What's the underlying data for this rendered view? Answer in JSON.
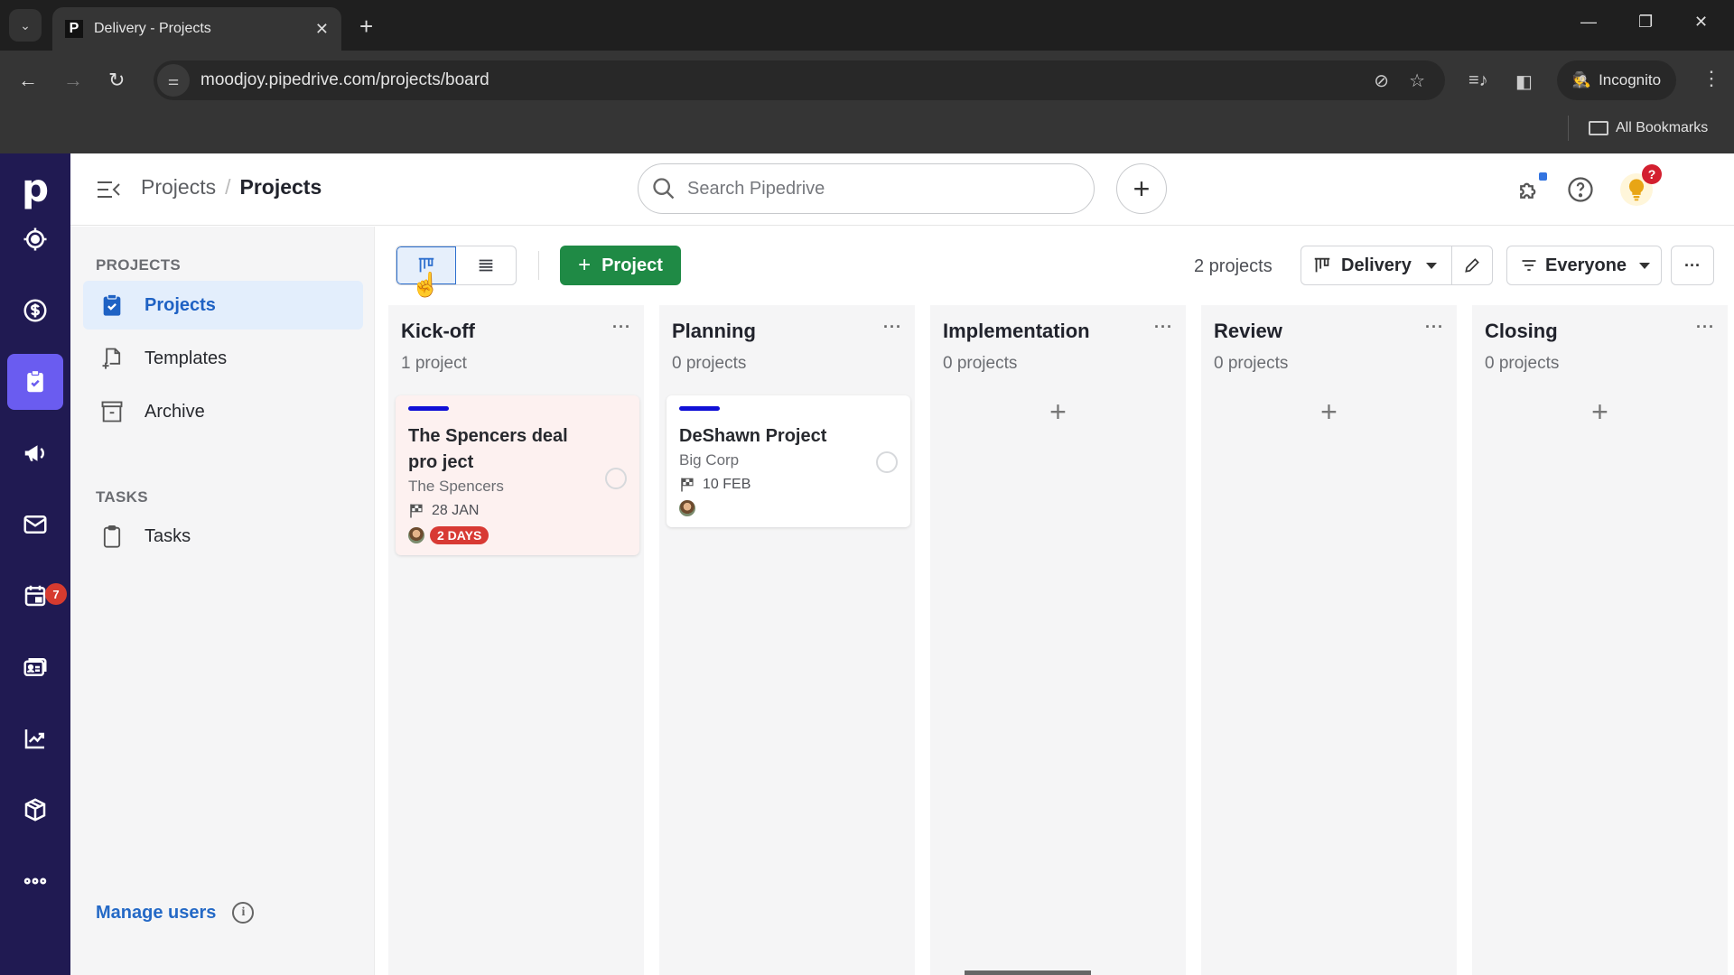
{
  "browser": {
    "tab_title": "Delivery - Projects",
    "tab_favicon": "P",
    "url": "moodjoy.pipedrive.com/projects/board",
    "profile_label": "Incognito",
    "bookmarks_label": "All Bookmarks"
  },
  "app": {
    "logo": "p",
    "rail": [
      {
        "name": "leads",
        "icon": "target-icon"
      },
      {
        "name": "deals",
        "icon": "dollar-icon"
      },
      {
        "name": "projects",
        "icon": "clipboard-check-icon",
        "active": true
      },
      {
        "name": "campaigns",
        "icon": "megaphone-icon"
      },
      {
        "name": "mail",
        "icon": "mail-icon"
      },
      {
        "name": "activities",
        "icon": "calendar-icon",
        "badge": "7"
      },
      {
        "name": "contacts",
        "icon": "contact-card-icon"
      },
      {
        "name": "insights",
        "icon": "chart-icon"
      },
      {
        "name": "products",
        "icon": "box-icon"
      },
      {
        "name": "more",
        "icon": "more-icon"
      }
    ],
    "header": {
      "breadcrumb_parent": "Projects",
      "breadcrumb_sep": "/",
      "breadcrumb_current": "Projects",
      "search_placeholder": "Search Pipedrive",
      "quick_add": "+",
      "tips_badge": "?"
    },
    "sidebar": {
      "section_projects": "PROJECTS",
      "items": [
        {
          "label": "Projects",
          "active": true
        },
        {
          "label": "Templates"
        },
        {
          "label": "Archive"
        }
      ],
      "section_tasks": "TASKS",
      "task_items": [
        {
          "label": "Tasks"
        }
      ],
      "manage_users": "Manage users",
      "info": "i"
    },
    "toolbar": {
      "add_project": "Project",
      "project_count": "2 projects",
      "pipeline": "Delivery",
      "filter": "Everyone",
      "more": "···"
    },
    "columns": [
      {
        "title": "Kick-off",
        "count": "1 project",
        "cards": [
          {
            "title": "The Spencers deal pro ject",
            "org": "The Spencers",
            "date": "28 JAN",
            "badge": "2 DAYS",
            "overdue": true,
            "bar_color": "#1010d6"
          }
        ]
      },
      {
        "title": "Planning",
        "count": "0 projects",
        "cards": [
          {
            "title": "DeShawn Project",
            "org": "Big Corp",
            "date": "10 FEB",
            "overdue": false,
            "bar_color": "#1010d6"
          }
        ]
      },
      {
        "title": "Implementation",
        "count": "0 projects",
        "cards": []
      },
      {
        "title": "Review",
        "count": "0 projects",
        "cards": []
      },
      {
        "title": "Closing",
        "count": "0 projects",
        "cards": []
      }
    ],
    "column_more": "···",
    "column_add": "+"
  },
  "colors": {
    "rail_bg": "#201a52",
    "rail_active": "#6a5cf0",
    "primary_green": "#1f8a45",
    "link_blue": "#2469c6",
    "overdue_red": "#d83a34",
    "fab": "#5b52e8"
  }
}
